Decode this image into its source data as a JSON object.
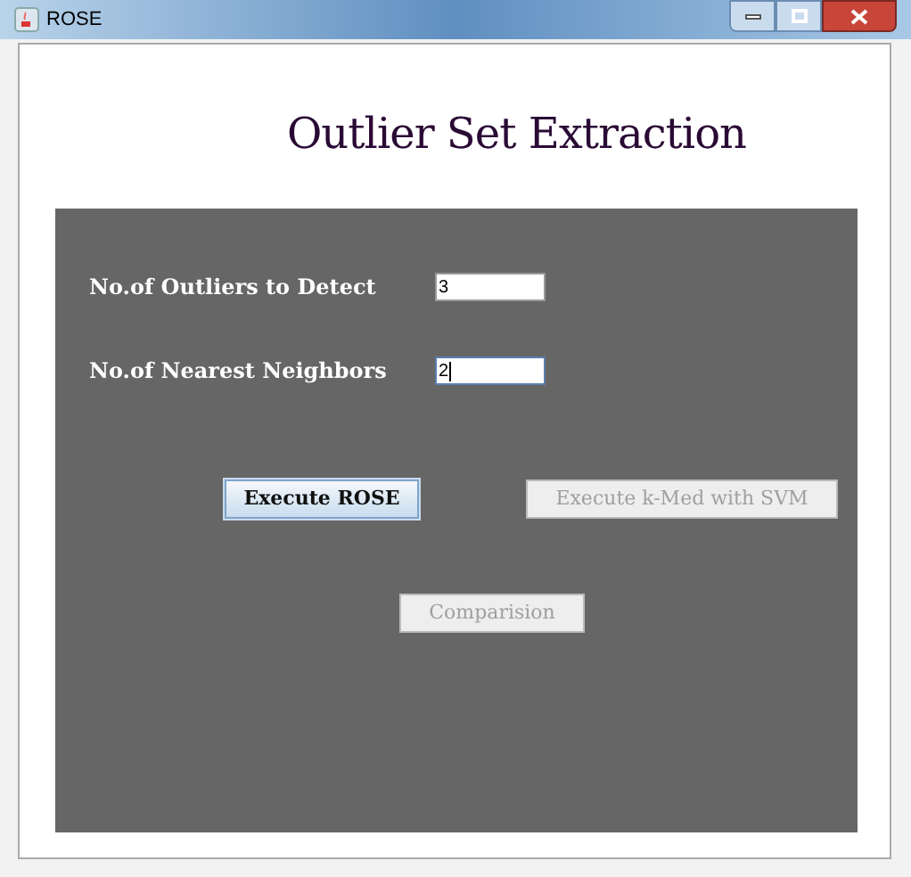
{
  "window": {
    "title": "ROSE"
  },
  "heading": "Outlier Set Extraction",
  "fields": [
    {
      "label": "No.of Outliers to Detect",
      "value": "3",
      "focused": false
    },
    {
      "label": "No.of Nearest Neighbors",
      "value": "2",
      "focused": true
    }
  ],
  "buttons": [
    {
      "label": "Execute ROSE",
      "disabled": false
    },
    {
      "label": "Execute k-Med with SVM",
      "disabled": true
    },
    {
      "label": "Comparision",
      "disabled": true
    }
  ]
}
